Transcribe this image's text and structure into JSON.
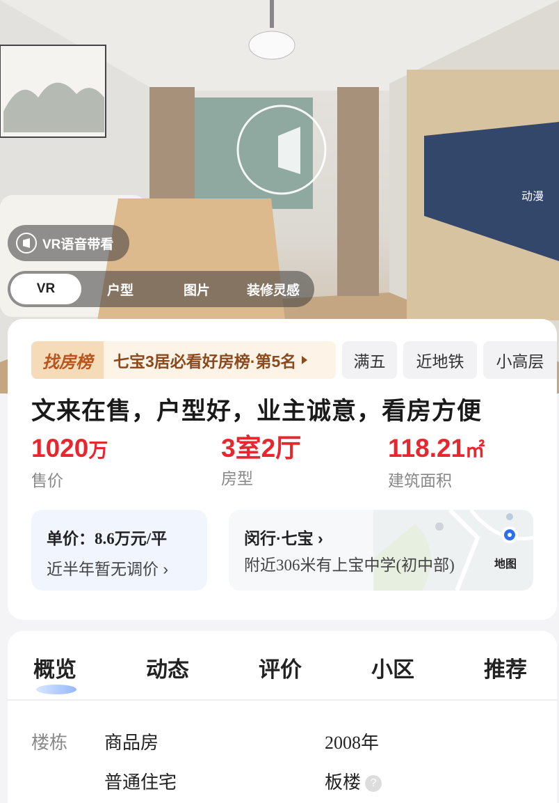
{
  "hero": {
    "vr_voice_label": "VR语音带看",
    "media_tabs": [
      {
        "label": "VR",
        "active": true
      },
      {
        "label": "户型",
        "active": false
      },
      {
        "label": "图片",
        "active": false
      },
      {
        "label": "装修灵感",
        "active": false
      }
    ],
    "tv_text": "动漫"
  },
  "listing": {
    "rank_logo": "找房榜",
    "rank_text": "七宝3居必看好房榜·第5名",
    "tags": [
      "满五",
      "近地铁",
      "小高层"
    ],
    "title": "文来在售，户型好，业主诚意，看房方便",
    "stats": [
      {
        "value": "1020",
        "unit": "万",
        "label": "售价"
      },
      {
        "value": "3室2厅",
        "unit": "",
        "label": "房型"
      },
      {
        "value": "118.21",
        "unit": "㎡",
        "label": "建筑面积"
      }
    ],
    "unit_price": "单价：8.6万元/平",
    "price_note": "近半年暂无调价 ›",
    "location": "闵行·七宝 ›",
    "nearby": "附近306米有上宝中学(初中部)",
    "map_label": "地图"
  },
  "overview": {
    "tabs": [
      "概览",
      "动态",
      "评价",
      "小区",
      "推荐"
    ],
    "active_tab": "概览",
    "row_label": "楼栋",
    "cells": [
      "商品房",
      "2008年",
      "普通住宅",
      "板楼"
    ],
    "help_icon": "?"
  },
  "colors": {
    "accent_red": "#e8262e",
    "rank_brown": "#8a4a1e",
    "rank_bg": "#fdf3e7"
  }
}
